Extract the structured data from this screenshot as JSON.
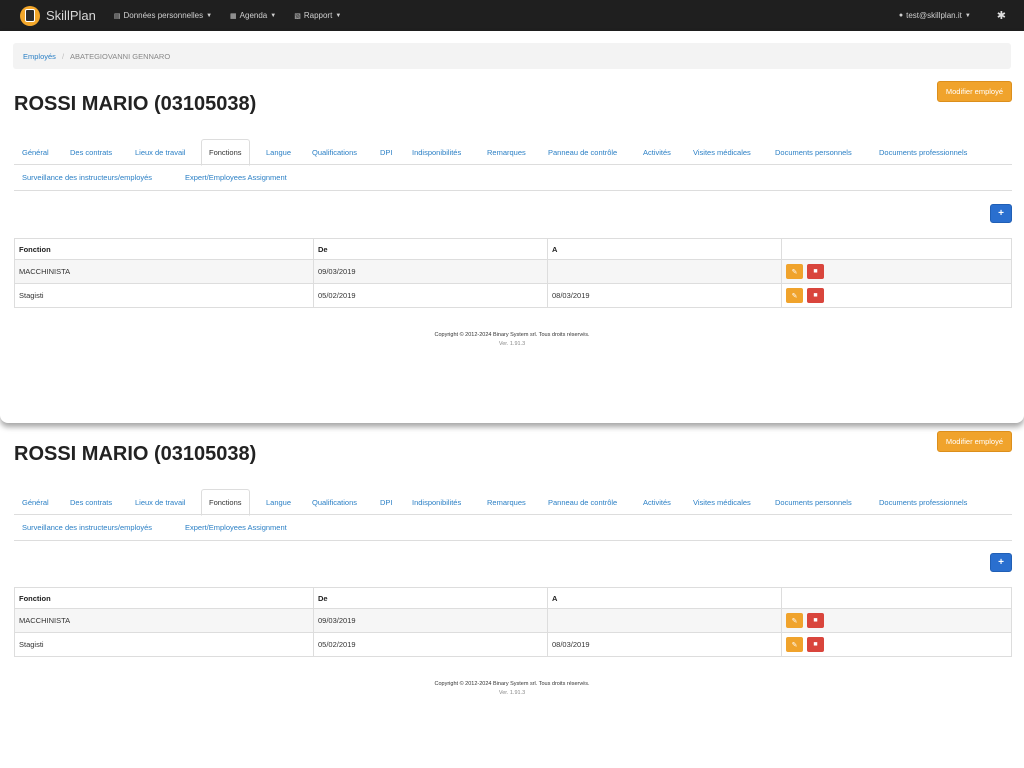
{
  "navbar": {
    "brand": "SkillPlan",
    "menus": [
      {
        "label": "Données personnelles",
        "icon": "folder-icon"
      },
      {
        "label": "Agenda",
        "icon": "calendar-icon"
      },
      {
        "label": "Rapport",
        "icon": "report-icon"
      }
    ],
    "user": "test@skillplan.it"
  },
  "breadcrumb": {
    "root": "Employés",
    "current": "ABATEGIOVANNI GENNARO"
  },
  "employee": {
    "title": "ROSSI MARIO (03105038)",
    "edit_label": "Modifier employé"
  },
  "tabs": [
    "Général",
    "Des contrats",
    "Lieux de travail",
    "Fonctions",
    "Langue",
    "Qualifications",
    "DPI",
    "Indisponibilités",
    "Remarques",
    "Panneau de contrôle",
    "Activités",
    "Visites médicales",
    "Documents personnels",
    "Documents professionnels",
    "Surveillance des instructeurs/employés",
    "Expert/Employees Assignment"
  ],
  "active_tab": "Fonctions",
  "add_label": "+",
  "table": {
    "headers": [
      "Fonction",
      "De",
      "A",
      ""
    ],
    "rows": [
      [
        "MACCHINISTA",
        "09/03/2019",
        ""
      ],
      [
        "Stagisti",
        "05/02/2019",
        "08/03/2019"
      ]
    ]
  },
  "footer": {
    "copyright": "Copyright © 2012-2024 Binary System srl. Tous droits réservés.",
    "version": "Ver. 1.91.3"
  },
  "colors": {
    "navbar": "#1f1f1f",
    "accent_orange": "#f0a32c",
    "accent_blue": "#2a6fcf",
    "danger": "#d9453c",
    "link": "#2a7fc5"
  }
}
